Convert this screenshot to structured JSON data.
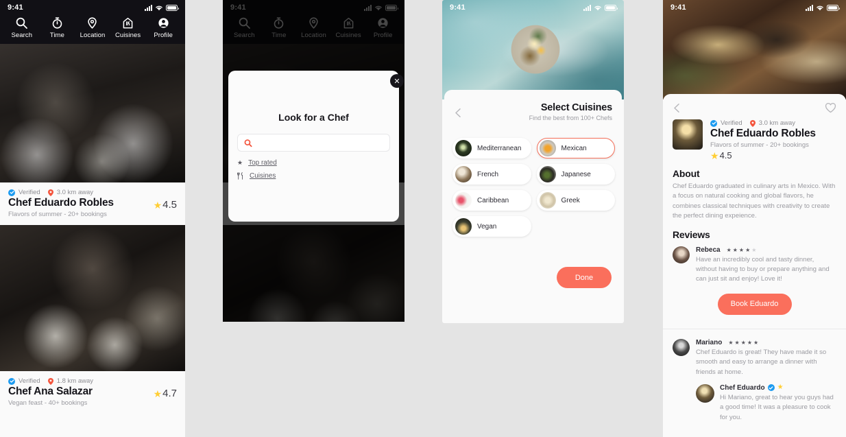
{
  "status_bar": {
    "time": "9:41",
    "signal_icon": "cellular-bars-icon",
    "wifi_icon": "wifi-icon",
    "battery_icon": "battery-icon"
  },
  "nav": {
    "items": [
      {
        "label": "Search",
        "icon": "search-icon"
      },
      {
        "label": "Time",
        "icon": "stopwatch-icon"
      },
      {
        "label": "Location",
        "icon": "map-pin-icon"
      },
      {
        "label": "Cuisines",
        "icon": "restaurant-house-icon"
      },
      {
        "label": "Profile",
        "icon": "user-circle-icon"
      }
    ]
  },
  "screen1": {
    "chefs": [
      {
        "verified_label": "Verified",
        "distance": "3.0 km away",
        "name": "Chef Eduardo Robles",
        "tagline": "Flavors of summer - 20+ bookings",
        "rating": "4.5"
      },
      {
        "verified_label": "Verified",
        "distance": "1.8 km away",
        "name": "Chef Ana Salazar",
        "tagline": "Vegan feast - 40+ bookings",
        "rating": "4.7"
      }
    ]
  },
  "screen2": {
    "modal": {
      "close_icon": "close-x-icon",
      "title": "Look for a Chef",
      "search_placeholder": "",
      "search_value": "",
      "search_icon": "search-icon",
      "links": [
        {
          "label": "Top rated",
          "icon": "star-icon"
        },
        {
          "label": "Cuisines",
          "icon": "cutlery-icon"
        }
      ]
    }
  },
  "screen3": {
    "back_icon": "chevron-left-icon",
    "title": "Select Cuisines",
    "subtitle": "Find the best from 100+ Chefs",
    "cuisines_left": [
      {
        "label": "Mediterranean",
        "selected": false
      },
      {
        "label": "French",
        "selected": false
      },
      {
        "label": "Caribbean",
        "selected": false
      },
      {
        "label": "Vegan",
        "selected": false
      }
    ],
    "cuisines_right": [
      {
        "label": "Mexican",
        "selected": true
      },
      {
        "label": "Japanese",
        "selected": false
      },
      {
        "label": "Greek",
        "selected": false
      }
    ],
    "done_label": "Done"
  },
  "screen4": {
    "back_icon": "chevron-left-icon",
    "favorite_icon": "heart-outline-icon",
    "verified_label": "Verified",
    "distance": "3.0 km away",
    "name": "Chef Eduardo Robles",
    "tagline": "Flavors of summer - 20+ bookings",
    "rating": "4.5",
    "about_heading": "About",
    "about_text": "Chef Eduardo graduated in culinary arts in Mexico. With a focus on natural cooking and global flavors, he combines classical techniques with creativity to create the perfect dining expeience.",
    "reviews_heading": "Reviews",
    "reviews": [
      {
        "name": "Rebeca",
        "stars_filled": 4,
        "stars_total": 5,
        "text": "Have an incredibly cool and tasty dinner, without having to buy or prepare anything and can just sit and enjoy! Love it!"
      },
      {
        "name": "Mariano",
        "stars_filled": 5,
        "stars_total": 5,
        "text": "Chef Eduardo is great! They have made it so smooth and easy to arrange a dinner with friends at home.",
        "reply": {
          "name": "Chef Eduardo",
          "verified_icon": "verified-check-icon",
          "star_icon": "star-icon",
          "text": "Hi Mariano, great to hear you guys had a good time! It was a pleasure to cook for you."
        }
      }
    ],
    "book_label": "Book Eduardo"
  },
  "colors": {
    "accent": "#fa6f5c",
    "verified_blue": "#1d9bf0",
    "star_yellow": "#ffce34",
    "nav_dark": "#111015",
    "page_bg": "#e4e4e4"
  }
}
